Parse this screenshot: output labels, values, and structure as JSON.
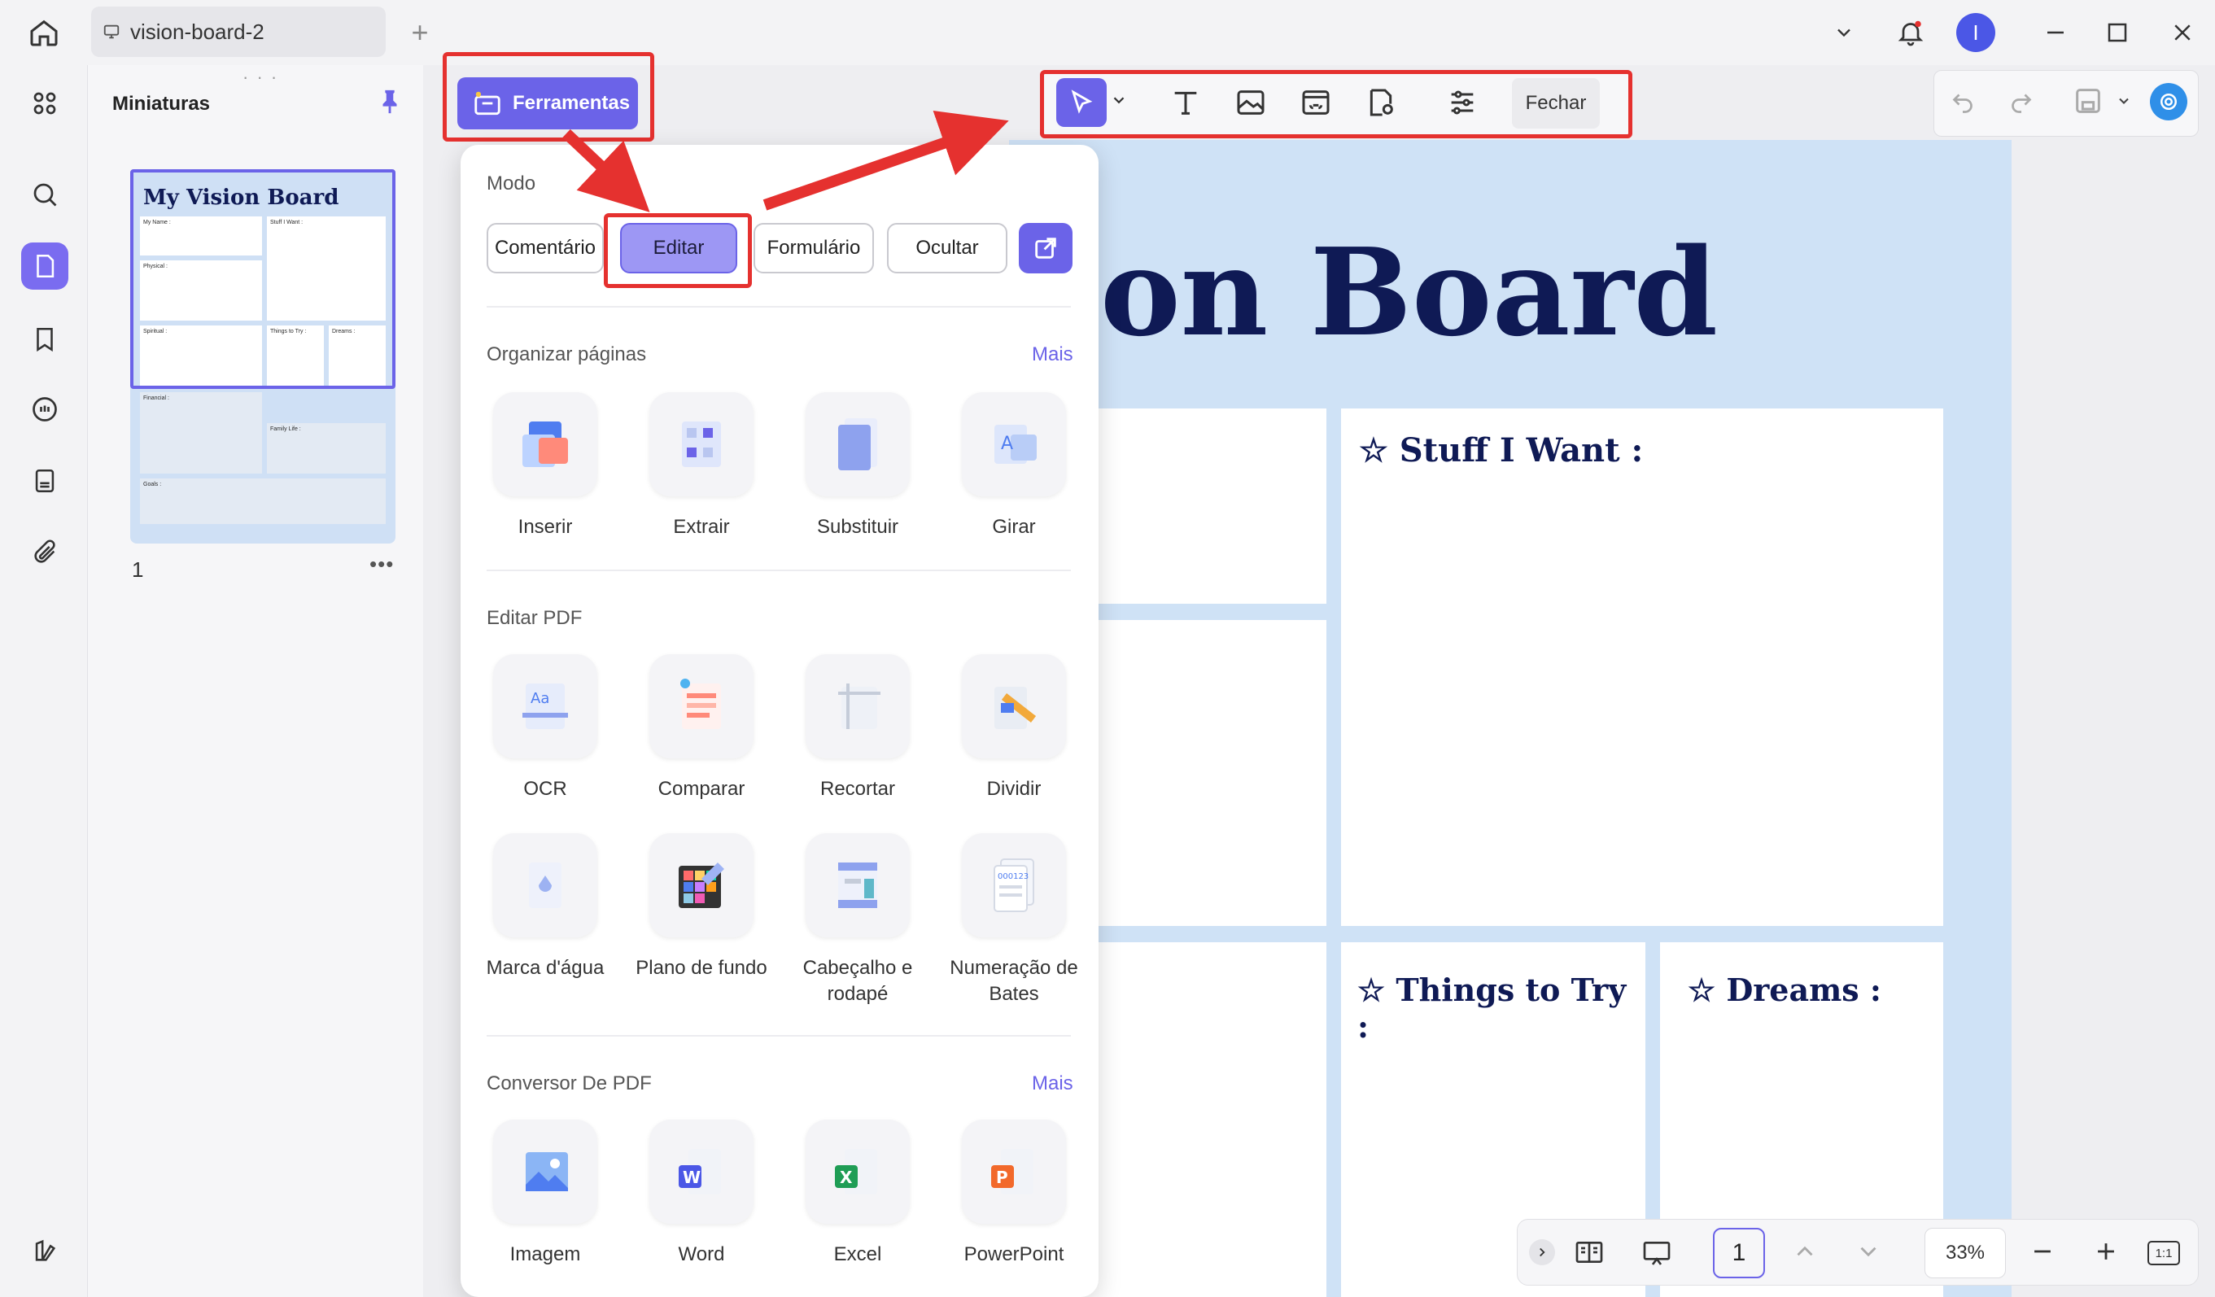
{
  "tab": {
    "title": "vision-board-2"
  },
  "user": {
    "initial": "I"
  },
  "thumbnails": {
    "title": "Miniaturas",
    "page_number": "1",
    "thumb_title": "My Vision Board",
    "thumb_labels": [
      "My Name :",
      "Stuff I Want :",
      "Physical :",
      "Spiritual :",
      "Things to Try :",
      "Dreams :",
      "Financial :",
      "Family Life :",
      "Goals :"
    ]
  },
  "toolbar": {
    "ferramentas_label": "Ferramentas",
    "fechar_label": "Fechar"
  },
  "menu": {
    "mode_label": "Modo",
    "modes": [
      "Comentário",
      "Editar",
      "Formulário",
      "Ocultar"
    ],
    "organize": {
      "title": "Organizar páginas",
      "more": "Mais",
      "items": [
        "Inserir",
        "Extrair",
        "Substituir",
        "Girar"
      ]
    },
    "edit_pdf": {
      "title": "Editar PDF",
      "items": [
        "OCR",
        "Comparar",
        "Recortar",
        "Dividir",
        "Marca d'água",
        "Plano de fundo",
        "Cabeçalho e rodapé",
        "Numeração de Bates"
      ]
    },
    "converter": {
      "title": "Conversor De PDF",
      "more": "Mais",
      "items": [
        "Imagem",
        "Word",
        "Excel",
        "PowerPoint"
      ]
    }
  },
  "document": {
    "title_fragment": "on Board",
    "sections": [
      "Stuff I Want :",
      "Things to Try :",
      "Dreams :"
    ]
  },
  "bottom_nav": {
    "page": "1",
    "zoom": "33%",
    "fit_label": "1:1"
  },
  "colors": {
    "accent": "#6b63e8",
    "highlight_red": "#e5312f",
    "page_bg": "#cfe2f6",
    "heading": "#0f1a55"
  }
}
